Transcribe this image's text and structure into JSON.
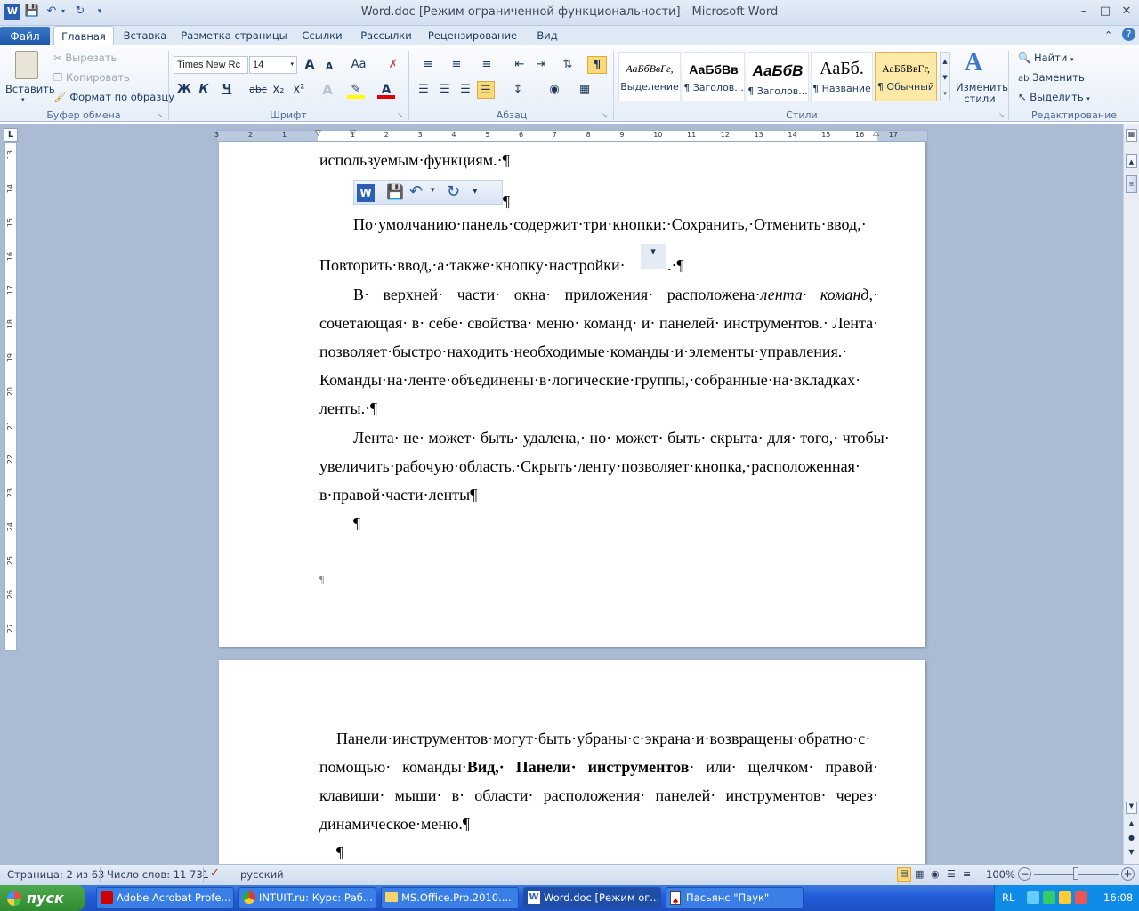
{
  "titlebar": {
    "title": "Word.doc [Режим ограниченной функциональности] - Microsoft Word",
    "qat": [
      "word-icon",
      "save-icon",
      "undo-icon",
      "redo-icon",
      "customize-qat-icon"
    ],
    "controls": {
      "minimize": "–",
      "maximize": "□",
      "close": "✕"
    }
  },
  "tabs": {
    "file": "Файл",
    "items": [
      "Главная",
      "Вставка",
      "Разметка страницы",
      "Ссылки",
      "Рассылки",
      "Рецензирование",
      "Вид"
    ],
    "active": "Главная"
  },
  "ribbon": {
    "clipboard": {
      "paste": "Вставить",
      "cut": "Вырезать",
      "copy": "Копировать",
      "format_painter": "Формат по образцу",
      "label": "Буфер обмена"
    },
    "font": {
      "name": "Times New Rc",
      "size": "14",
      "bold": "Ж",
      "italic": "К",
      "underline": "Ч",
      "strike": "abc",
      "sub": "x₂",
      "sup": "x²",
      "grow": "A",
      "shrink": "A",
      "case": "Aa",
      "label": "Шрифт"
    },
    "paragraph": {
      "label": "Абзац",
      "pilcrow": "¶"
    },
    "styles": {
      "label": "Стили",
      "items": [
        {
          "sample": "АаБбВвГг,",
          "name": "Выделение"
        },
        {
          "sample": "АаБбВв",
          "name": "¶ Заголов..."
        },
        {
          "sample": "АаБбВ",
          "name": "¶ Заголов..."
        },
        {
          "sample": "АаБб.",
          "name": "¶ Название"
        },
        {
          "sample": "АаБбВвГг,",
          "name": "¶ Обычный"
        }
      ],
      "change_styles": "Изменить стили"
    },
    "editing": {
      "find": "Найти",
      "replace": "Заменить",
      "select": "Выделить",
      "label": "Редактирование"
    }
  },
  "ruler": {
    "h_ticks": [
      "3",
      "2",
      "1",
      "1",
      "2",
      "3",
      "4",
      "5",
      "6",
      "7",
      "8",
      "9",
      "10",
      "11",
      "12",
      "13",
      "14",
      "15",
      "16",
      "17"
    ],
    "v_ticks": [
      "13",
      "14",
      "15",
      "16",
      "17",
      "18",
      "19",
      "20",
      "21",
      "22",
      "23",
      "24",
      "25",
      "26",
      "27"
    ]
  },
  "document": {
    "page1": {
      "line1": "используемым·функциям.·¶",
      "qat_pilcrow": "¶",
      "p2_line1": "По·умолчанию·панель·содержит·три·кнопки:·Сохранить,·Отменить·ввод,·",
      "p2_line2": "Повторить·ввод,·а·также·кнопку·настройки·",
      "p2_line2_end": ".·¶",
      "p3_line1_a": "В· верхней· части· окна· приложения· расположена·",
      "p3_line1_i": "лента· команд",
      "p3_line1_b": ",·",
      "p3_line2": "сочетающая· в· себе· свойства· меню· команд· и· панелей· инструментов.· Лента·",
      "p3_line3": "позволяет·быстро·находить·необходимые·команды·и·элементы·управления.·",
      "p3_line4": "Команды·на·ленте·объединены·в·логические·группы,·собранные·на·вкладках·",
      "p3_line5": "ленты.·¶",
      "p4_line1": "Лента· не· может· быть· удалена,· но· может· быть· скрыта· для· того,· чтобы·",
      "p4_line2": "увеличить·рабочую·область.·Скрыть·ленту·позволяет·кнопка,·расположенная·",
      "p4_line3": "в·правой·части·ленты¶",
      "empty1": "¶",
      "small_mark": "¶"
    },
    "page2": {
      "line1": "Панели·инструментов·могут·быть·убраны·с·экрана·и·возвращены·обратно·с·",
      "line2_a": "помощью· команды·",
      "line2_b": "Вид,· Панели· инструментов",
      "line2_c": "· или· щелчком· правой·",
      "line3": "клавиши· мыши· в· области· расположения· панелей· инструментов· через·",
      "line4": "динамическое·меню.¶",
      "empty": "¶"
    }
  },
  "status": {
    "page": "Страница: 2 из 63",
    "words": "Число слов: 11 731",
    "language": "русский",
    "zoom": "100%"
  },
  "taskbar": {
    "start": "пуск",
    "tasks": [
      "Adobe Acrobat Profe...",
      "INTUIT.ru: Курс: Раб...",
      "MS.Office.Pro.2010....",
      "Word.doc [Режим ог...",
      "Пасьянс \"Паук\""
    ],
    "lang": "RL",
    "time": "16:08"
  }
}
